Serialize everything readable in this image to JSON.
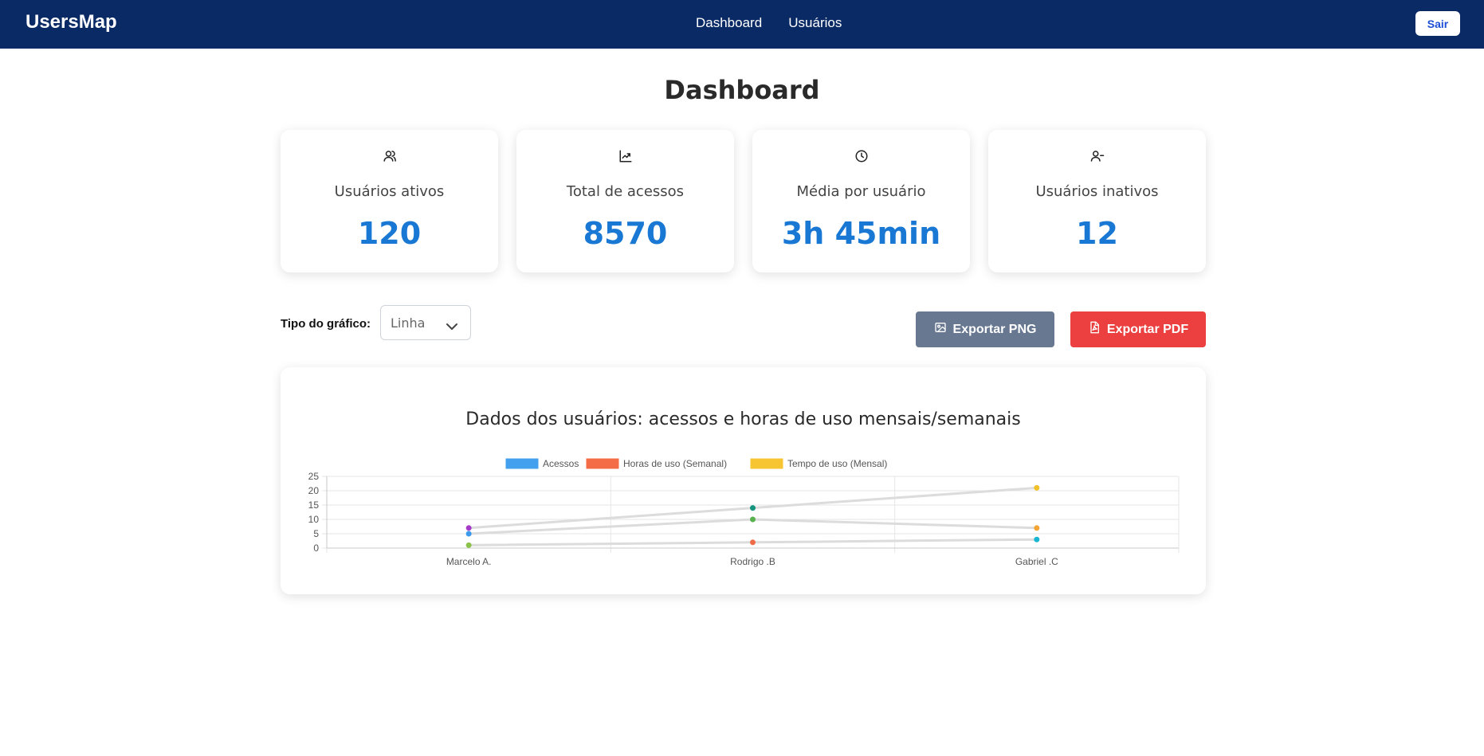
{
  "navbar": {
    "brand": "UsersMap",
    "links": [
      "Dashboard",
      "Usuários"
    ],
    "logout": "Sair"
  },
  "page": {
    "title": "Dashboard"
  },
  "stats": [
    {
      "icon": "users-icon",
      "label": "Usuários ativos",
      "value": "120"
    },
    {
      "icon": "chart-trend-icon",
      "label": "Total de acessos",
      "value": "8570"
    },
    {
      "icon": "clock-icon",
      "label": "Média por usuário",
      "value": "3h 45min"
    },
    {
      "icon": "user-minus-icon",
      "label": "Usuários inativos",
      "value": "12"
    }
  ],
  "controls": {
    "chart_type_label": "Tipo do gráfico:",
    "chart_type_value": "Linha",
    "export_png": "Exportar PNG",
    "export_pdf": "Exportar PDF"
  },
  "colors": {
    "navbar": "#0a2a66",
    "accent_value": "#1978d4",
    "export_png": "#687891",
    "export_pdf": "#ec4040"
  },
  "chart_data": {
    "type": "line",
    "title": "Dados dos usuários: acessos e horas de uso mensais/semanais",
    "categories": [
      "Marcelo A.",
      "Rodrigo .B",
      "Gabriel .C"
    ],
    "ylim": [
      0,
      25
    ],
    "yticks": [
      0,
      5,
      10,
      15,
      20,
      25
    ],
    "grid": true,
    "legend_position": "top",
    "legend": [
      {
        "name": "Acessos",
        "color": "#42a0ee"
      },
      {
        "name": "Horas de uso (Semanal)",
        "color": "#f36c45"
      },
      {
        "name": "Tempo de uso (Mensal)",
        "color": "#f7c531"
      }
    ],
    "series": [
      {
        "values": [
          7,
          14,
          21
        ],
        "points": [
          "#a43bc8",
          "#15957f",
          "#f1c12a"
        ]
      },
      {
        "values": [
          5,
          10,
          7
        ],
        "points": [
          "#3d9aea",
          "#58b04e",
          "#f4a433"
        ]
      },
      {
        "values": [
          1,
          2,
          3
        ],
        "points": [
          "#8bc34a",
          "#f06c48",
          "#17b6d3"
        ]
      }
    ]
  }
}
